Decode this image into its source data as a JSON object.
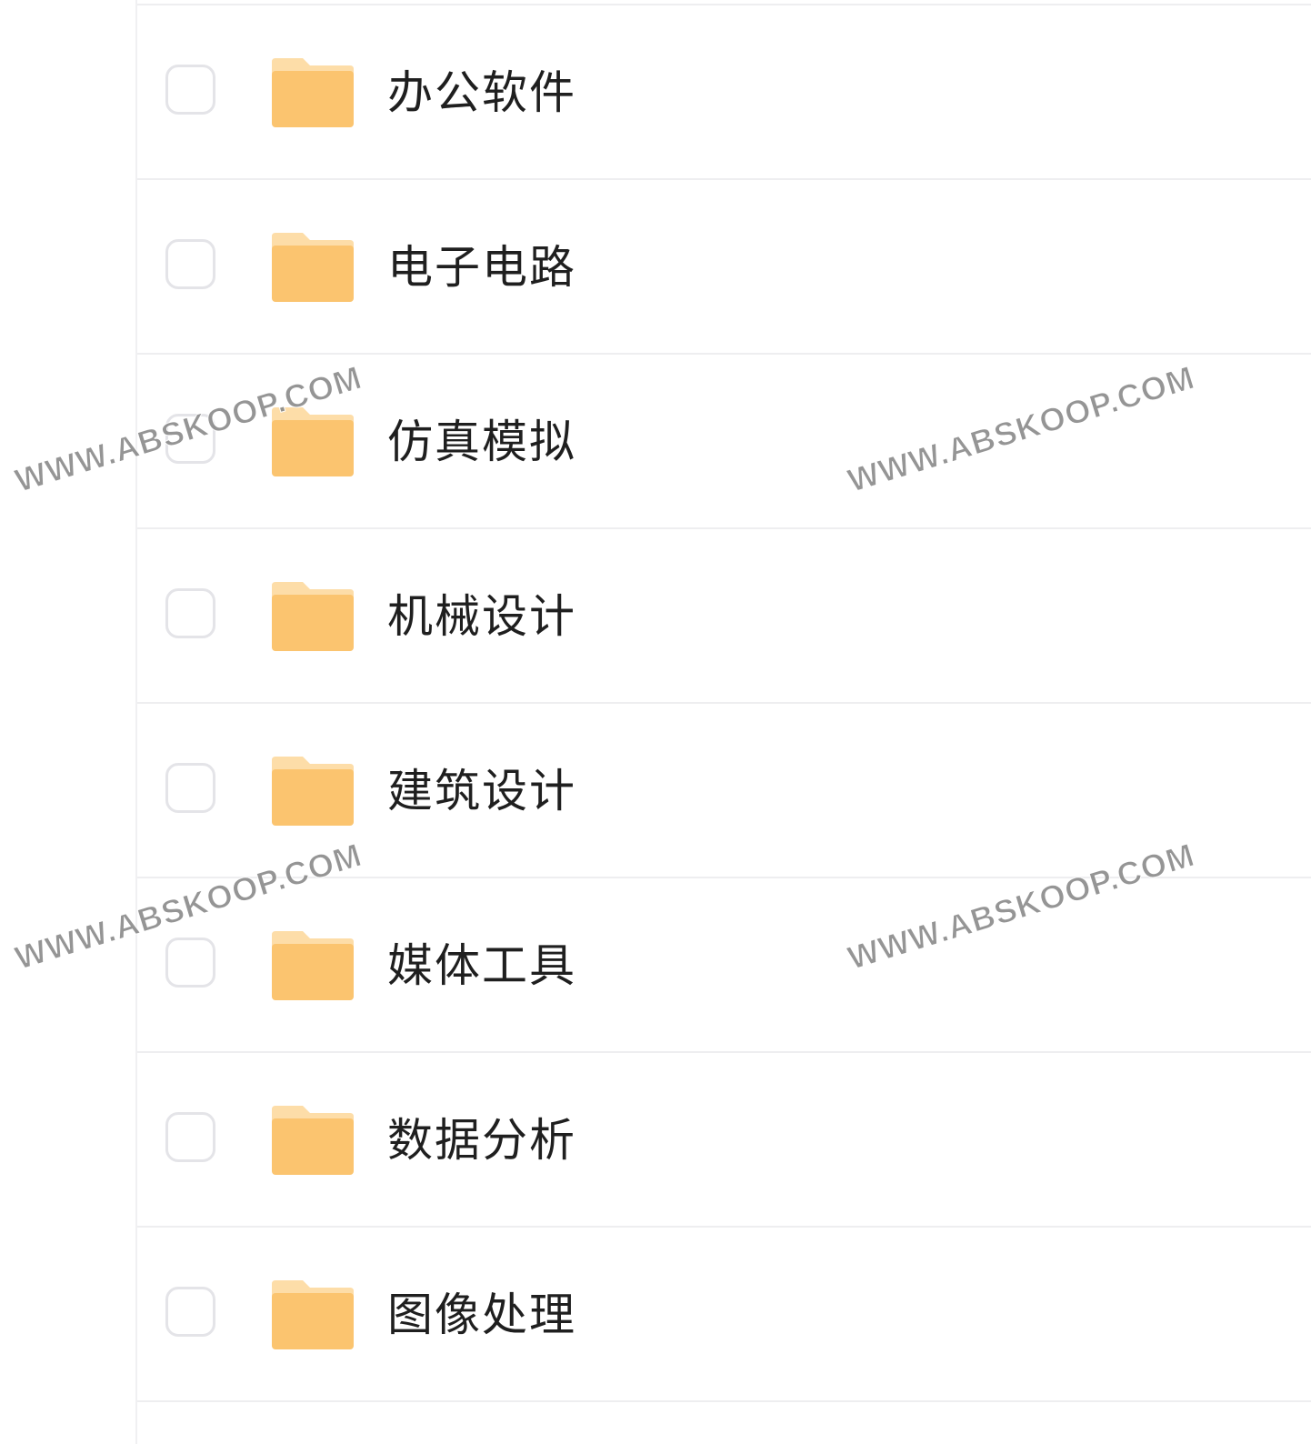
{
  "file_list": {
    "items": [
      {
        "name": "办公软件",
        "type": "folder",
        "icon": "folder-icon"
      },
      {
        "name": "电子电路",
        "type": "folder",
        "icon": "folder-icon"
      },
      {
        "name": "仿真模拟",
        "type": "folder",
        "icon": "folder-icon"
      },
      {
        "name": "机械设计",
        "type": "folder",
        "icon": "folder-icon"
      },
      {
        "name": "建筑设计",
        "type": "folder",
        "icon": "folder-icon"
      },
      {
        "name": "媒体工具",
        "type": "folder",
        "icon": "folder-icon"
      },
      {
        "name": "数据分析",
        "type": "folder",
        "icon": "folder-icon"
      },
      {
        "name": "图像处理",
        "type": "folder",
        "icon": "folder-icon"
      }
    ]
  },
  "watermark": {
    "text": "WWW.ABSKOOP.COM"
  },
  "colors": {
    "folder_body": "#fbc46f",
    "folder_tab": "#fddda8",
    "checkbox_border": "#e4e4e8",
    "row_divider": "#eeeef0",
    "text": "#1f1f1f"
  }
}
